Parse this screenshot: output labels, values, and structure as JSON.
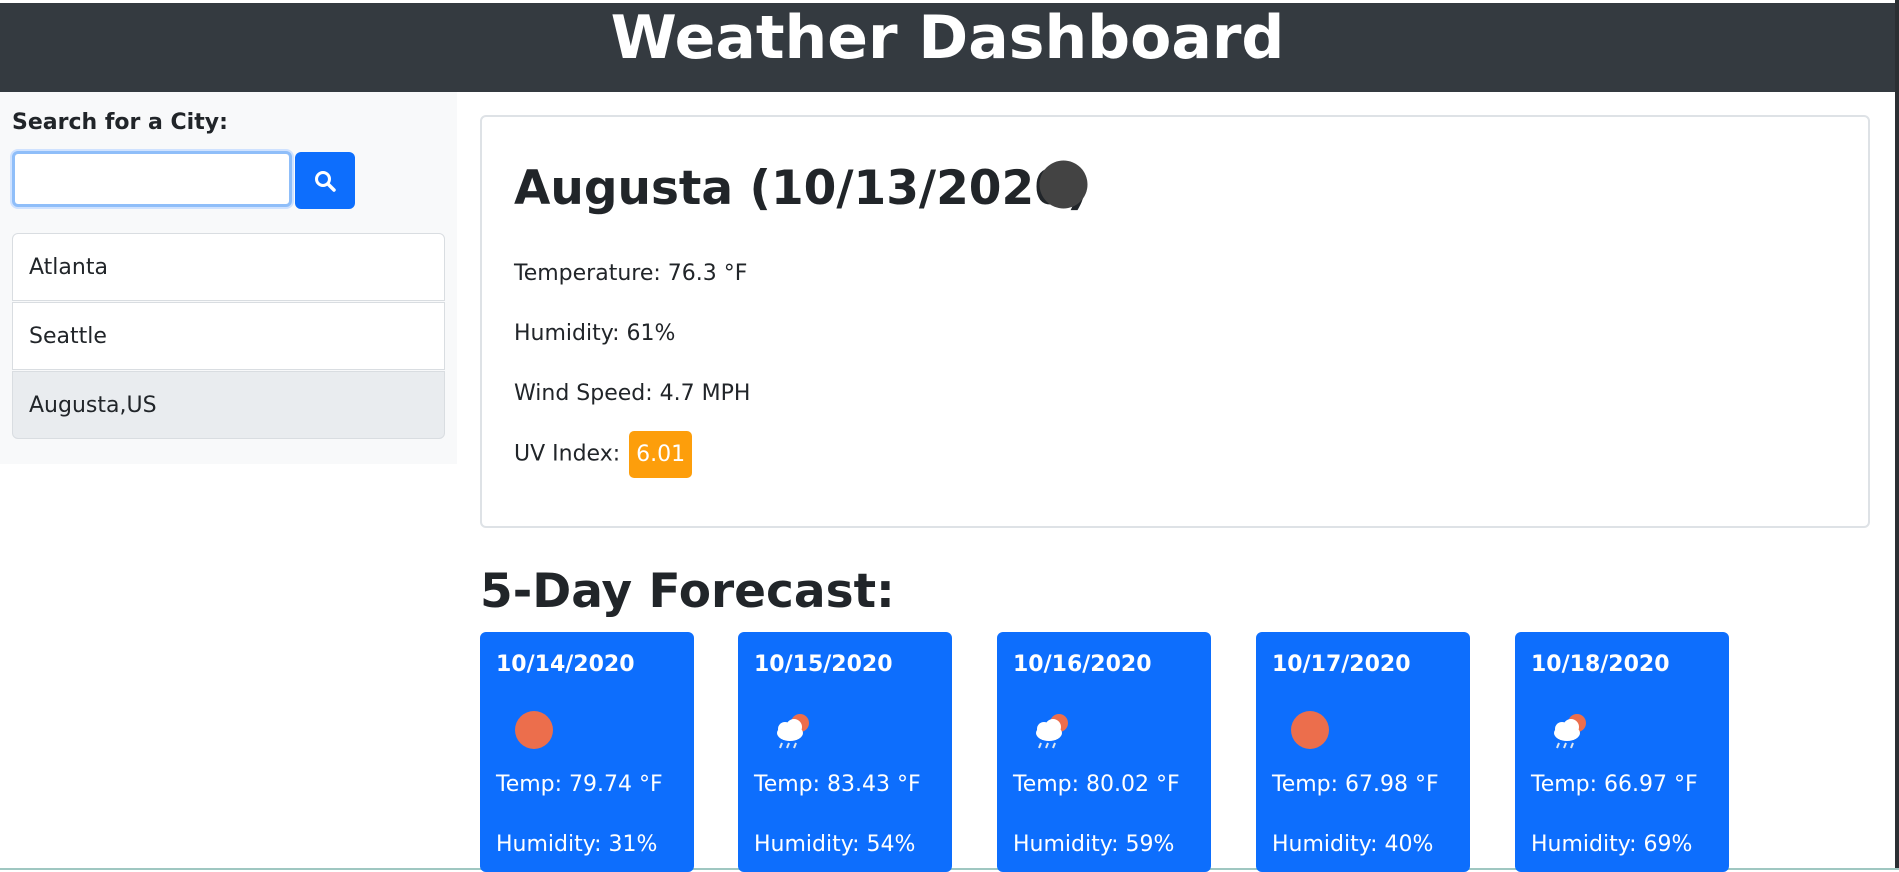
{
  "header": {
    "title": "Weather Dashboard"
  },
  "search": {
    "label": "Search for a City:",
    "placeholder": "",
    "value": ""
  },
  "history": [
    {
      "label": "Atlanta",
      "active": false
    },
    {
      "label": "Seattle",
      "active": false
    },
    {
      "label": "Augusta,US",
      "active": true
    }
  ],
  "current": {
    "heading": "Augusta (10/13/2020)",
    "icon": "dark-circle-icon",
    "temperature": "Temperature: 76.3 °F",
    "humidity": "Humidity: 61%",
    "wind": "Wind Speed: 4.7 MPH",
    "uv_label": "UV Index:",
    "uv_value": "6.01",
    "uv_color": "#fd9e0b"
  },
  "forecast": {
    "title": "5-Day Forecast:",
    "days": [
      {
        "date": "10/14/2020",
        "icon": "sun-icon",
        "temp": "Temp: 79.74 °F",
        "humidity": "Humidity: 31%"
      },
      {
        "date": "10/15/2020",
        "icon": "rain-cloud-icon",
        "temp": "Temp: 83.43 °F",
        "humidity": "Humidity: 54%"
      },
      {
        "date": "10/16/2020",
        "icon": "rain-cloud-icon",
        "temp": "Temp: 80.02 °F",
        "humidity": "Humidity: 59%"
      },
      {
        "date": "10/17/2020",
        "icon": "sun-icon",
        "temp": "Temp: 67.98 °F",
        "humidity": "Humidity: 40%"
      },
      {
        "date": "10/18/2020",
        "icon": "rain-cloud-icon",
        "temp": "Temp: 66.97 °F",
        "humidity": "Humidity: 69%"
      }
    ]
  },
  "colors": {
    "header_bg": "#343a40",
    "primary": "#0d6efd",
    "sun": "#ec6e4c"
  }
}
